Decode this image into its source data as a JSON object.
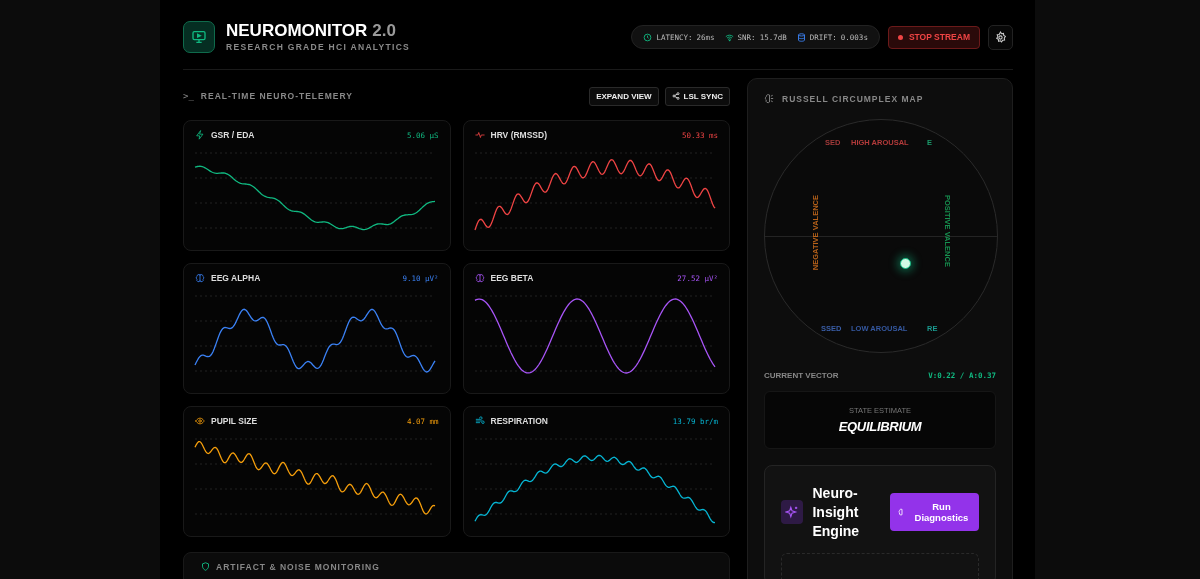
{
  "header": {
    "title": "NEUROMONITOR",
    "version": "2.0",
    "subtitle": "RESEARCH GRADE HCI ANALYTICS"
  },
  "status": [
    {
      "kind": "latency",
      "label": "LATENCY:",
      "value": "26ms"
    },
    {
      "kind": "snr",
      "label": "SNR:",
      "value": "15.7dB"
    },
    {
      "kind": "drift",
      "label": "DRIFT:",
      "value": "0.003s"
    }
  ],
  "stop_button": "STOP STREAM",
  "telemetry": {
    "title": "REAL-TIME NEURO-TELEMERY",
    "prompt": ">_",
    "buttons": [
      {
        "kind": "expand",
        "label": "EXPAND VIEW"
      },
      {
        "kind": "sync",
        "label": "LSL SYNC"
      }
    ],
    "signals": [
      {
        "kind": "gsr",
        "label": "GSR / EDA",
        "value": "5.06 µS",
        "color": "#10b981"
      },
      {
        "kind": "hrv",
        "label": "HRV (RMSSD)",
        "value": "50.33 ms",
        "color": "#ef4444"
      },
      {
        "kind": "alpha",
        "label": "EEG ALPHA",
        "value": "9.10 µV²",
        "color": "#3b82f6"
      },
      {
        "kind": "beta",
        "label": "EEG BETA",
        "value": "27.52 µV²",
        "color": "#a855f7"
      },
      {
        "kind": "pupil",
        "label": "PUPIL SIZE",
        "value": "4.07 mm",
        "color": "#f59e0b"
      },
      {
        "kind": "resp",
        "label": "RESPIRATION",
        "value": "13.79 br/m",
        "color": "#06b6d4"
      }
    ]
  },
  "artifact_panel": {
    "title": "ARTIFACT & NOISE MONITORING"
  },
  "circumplex": {
    "title": "RUSSELL CIRCUMPLEX MAP",
    "top": "HIGH AROUSAL",
    "bottom": "LOW AROUSAL",
    "left": "NEGATIVE VALENCE",
    "right": "POSITIVE VALENCE",
    "corners": [
      {
        "kind": "top-left",
        "label": "SED"
      },
      {
        "kind": "top-right",
        "label": "E"
      },
      {
        "kind": "bottom-left",
        "label": "SSED"
      },
      {
        "kind": "bottom-right",
        "label": "RE"
      }
    ],
    "vector_label": "CURRENT VECTOR",
    "vector_value": "V:0.22 / A:0.37",
    "state_label": "STATE ESTIMATE",
    "state": "EQUILIBRIUM"
  },
  "insight": {
    "title": "Neuro-Insight Engine",
    "button": "Run Diagnostics"
  }
}
